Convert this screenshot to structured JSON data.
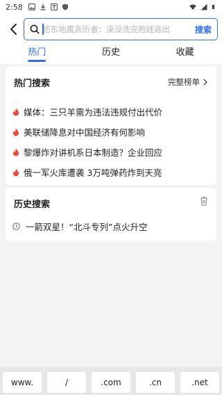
{
  "status": {
    "time": "2:58"
  },
  "search": {
    "placeholder": "把东地震亲历者：澡没洗完抱娃逃出",
    "button": "搜索"
  },
  "tabs": [
    {
      "label": "热门"
    },
    {
      "label": "历史"
    },
    {
      "label": "收藏"
    }
  ],
  "hot": {
    "title": "热门搜索",
    "more_label": "完整榜单",
    "items": [
      {
        "text": "媒体：三只羊需为违法违规付出代价"
      },
      {
        "text": "美联储降息对中国经济有何影响"
      },
      {
        "text": "黎爆炸对讲机系日本制造？企业回应"
      },
      {
        "text": "俄一军火库遭袭 3万吨弹药炸到天亮"
      }
    ]
  },
  "history": {
    "title": "历史搜索",
    "items": [
      {
        "text": "一箭双星！“北斗专列”点火升空"
      }
    ]
  },
  "keys": [
    {
      "label": "www."
    },
    {
      "label": "/"
    },
    {
      "label": ".com"
    },
    {
      "label": ".cn"
    },
    {
      "label": ".net"
    }
  ],
  "colors": {
    "accent": "#2f6cf3",
    "flame": "#f04a3a"
  }
}
